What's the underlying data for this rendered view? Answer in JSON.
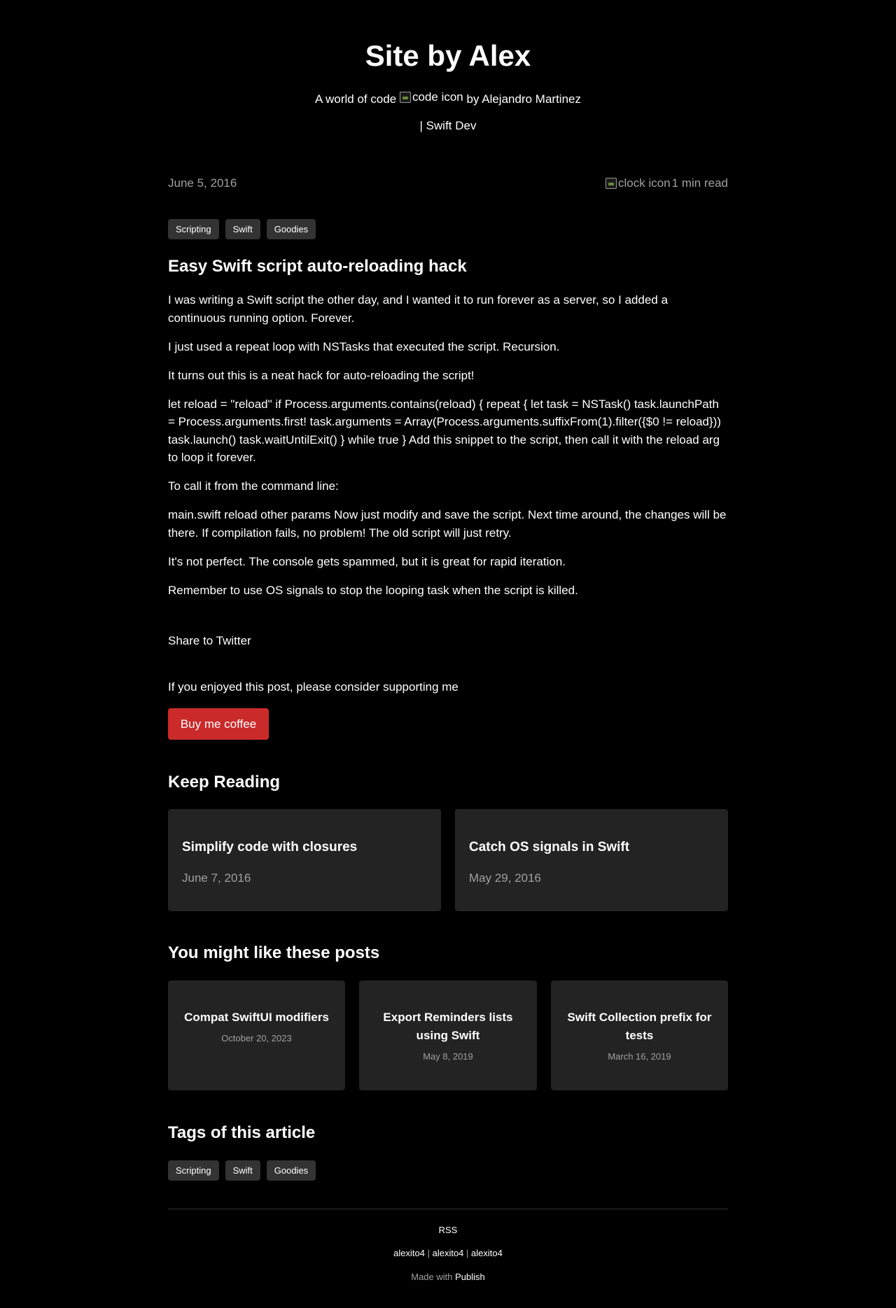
{
  "header": {
    "title": "Site by Alex",
    "subtitle_prefix": "A world of code",
    "code_icon_alt": "code icon",
    "subtitle_suffix": "by Alejandro Martinez",
    "tagline": "| Swift Dev"
  },
  "post": {
    "date": "June 5, 2016",
    "clock_icon_alt": "clock icon",
    "read_time": "1 min read",
    "tags": [
      "Scripting",
      "Swift",
      "Goodies"
    ],
    "title": "Easy Swift script auto-reloading hack",
    "paragraphs": [
      "I was writing a Swift script the other day, and I wanted it to run forever as a server, so I added a continuous running option. Forever.",
      "I just used a repeat loop with NSTasks that executed the script. Recursion.",
      "It turns out this is a neat hack for auto-reloading the script!",
      "let reload = \"reload\" if Process.arguments.contains(reload) { repeat { let task = NSTask() task.launchPath = Process.arguments.first! task.arguments = Array(Process.arguments.suffixFrom(1).filter({$0 != reload})) task.launch() task.waitUntilExit() } while true } Add this snippet to the script, then call it with the reload arg to loop it forever.",
      "To call it from the command line:",
      "main.swift reload other params Now just modify and save the script. Next time around, the changes will be there. If compilation fails, no problem! The old script will just retry.",
      "It's not perfect. The console gets spammed, but it is great for rapid iteration.",
      "Remember to use OS signals to stop the looping task when the script is killed."
    ],
    "share_label": "Share to Twitter",
    "support_text": "If you enjoyed this post, please consider supporting me",
    "coffee_button": "Buy me coffee"
  },
  "keep_reading": {
    "title": "Keep Reading",
    "items": [
      {
        "title": "Simplify code with closures",
        "date": "June 7, 2016"
      },
      {
        "title": "Catch OS signals in Swift",
        "date": "May 29, 2016"
      }
    ]
  },
  "might_like": {
    "title": "You might like these posts",
    "items": [
      {
        "title": "Compat SwiftUI modifiers",
        "date": "October 20, 2023"
      },
      {
        "title": "Export Reminders lists using Swift",
        "date": "May 8, 2019"
      },
      {
        "title": "Swift Collection prefix for tests",
        "date": "March 16, 2019"
      }
    ]
  },
  "article_tags": {
    "title": "Tags of this article",
    "tags": [
      "Scripting",
      "Swift",
      "Goodies"
    ]
  },
  "footer": {
    "rss": "RSS",
    "social": [
      "alexito4",
      "alexito4",
      "alexito4"
    ],
    "separator": "|",
    "made_with_prefix": "Made with",
    "made_with_link": "Publish"
  },
  "colors": {
    "background": "#000000",
    "card": "#232323",
    "tag": "#333333",
    "accent_button": "#cb2a2a",
    "muted_text": "#a0a0a0"
  }
}
